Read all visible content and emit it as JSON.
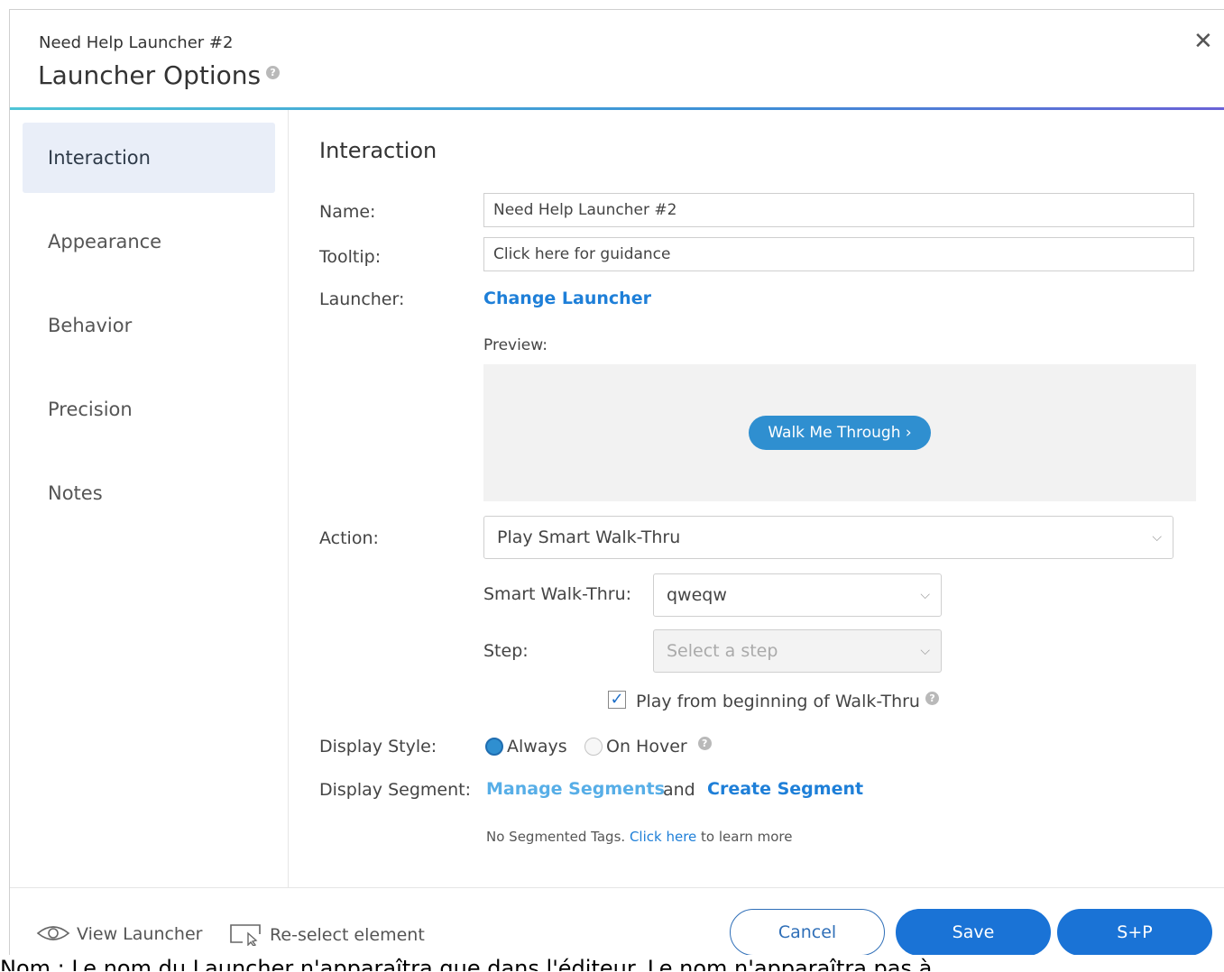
{
  "header": {
    "subtitle": "Need Help Launcher #2",
    "title": "Launcher Options",
    "help_glyph": "?",
    "close_glyph": "✕"
  },
  "sidebar": {
    "items": [
      {
        "label": "Interaction",
        "active": true
      },
      {
        "label": "Appearance",
        "active": false
      },
      {
        "label": "Behavior",
        "active": false
      },
      {
        "label": "Precision",
        "active": false
      },
      {
        "label": "Notes",
        "active": false
      }
    ]
  },
  "main": {
    "section_title": "Interaction",
    "name_label": "Name:",
    "name_value": "Need Help Launcher #2",
    "tooltip_label": "Tooltip:",
    "tooltip_value": "Click here for guidance",
    "launcher_label": "Launcher:",
    "change_launcher": "Change Launcher",
    "preview_label": "Preview:",
    "preview_button": "Walk Me Through ›",
    "action_label": "Action:",
    "action_value": "Play Smart Walk-Thru",
    "smart_walkthru_label": "Smart Walk-Thru:",
    "smart_walkthru_value": "qweqw",
    "step_label": "Step:",
    "step_placeholder": "Select a step",
    "play_from_beginning": "Play from beginning of Walk-Thru",
    "play_from_beginning_checked": true,
    "display_style_label": "Display Style:",
    "display_style_options": [
      "Always",
      "On Hover"
    ],
    "display_style_selected": "Always",
    "display_segment_label": "Display Segment:",
    "manage_segments": "Manage Segments",
    "and_text": "and",
    "create_segment": "Create Segment",
    "note_prefix": "No Segmented Tags.",
    "note_link": "Click here",
    "note_suffix": "to learn more"
  },
  "footer": {
    "view_launcher": "View Launcher",
    "reselect_element": "Re-select element",
    "cancel": "Cancel",
    "save": "Save",
    "save_publish": "S+P"
  },
  "caption": "Nom : Le nom du Launcher n'apparaîtra que dans l'éditeur. Le nom n'apparaîtra pas à",
  "colors": {
    "accent": "#1a73d6",
    "link": "#1e7fd8",
    "active_nav_bg": "#e9eef8",
    "preview_bg": "#f2f2f2"
  },
  "icons": {
    "close": "close-icon",
    "help": "help-icon",
    "eye": "eye-icon",
    "reselect": "cursor-select-icon",
    "chevron": "chevron-down-icon"
  }
}
